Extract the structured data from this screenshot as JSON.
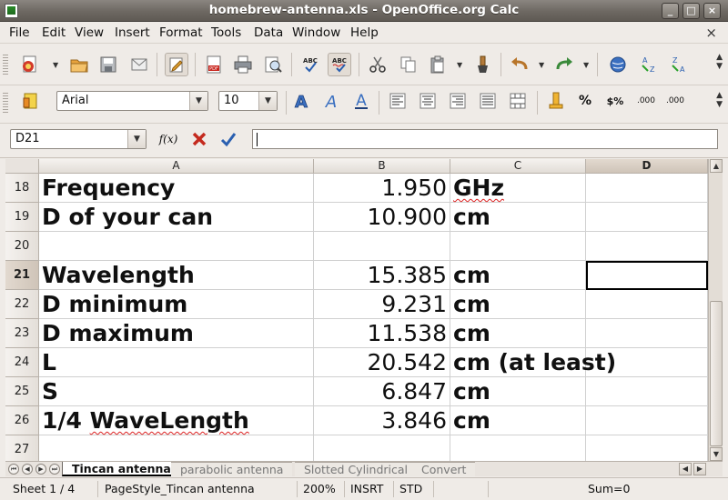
{
  "window": {
    "title": "homebrew-antenna.xls - OpenOffice.org Calc",
    "buttons": {
      "minimize": "_",
      "maximize": "□",
      "close": "×"
    }
  },
  "menu": {
    "items": [
      "File",
      "Edit",
      "View",
      "Insert",
      "Format",
      "Tools",
      "Data",
      "Window",
      "Help"
    ],
    "close_glyph": "×"
  },
  "toolbar_format": {
    "font_name": "Arial",
    "font_size": "10",
    "percent_label": "%",
    "currency_label": "$%",
    "add_decimal_label": ".000",
    "remove_decimal_label": ".000"
  },
  "formula_bar": {
    "name_box": "D21",
    "function_label": "f(x)",
    "input_value": ""
  },
  "sheet": {
    "columns": [
      "A",
      "B",
      "C",
      "D"
    ],
    "selected_column": "D",
    "selected_row": "21",
    "active_cell": "D21",
    "rows": [
      {
        "num": "18",
        "a": "Frequency",
        "b": "1.950",
        "c": "GHz",
        "d": ""
      },
      {
        "num": "19",
        "a": "D of your can",
        "b": "10.900",
        "c": "cm",
        "d": ""
      },
      {
        "num": "20",
        "a": "",
        "b": "",
        "c": "",
        "d": ""
      },
      {
        "num": "21",
        "a": "Wavelength",
        "b": "15.385",
        "c": "cm",
        "d": ""
      },
      {
        "num": "22",
        "a": "D minimum",
        "b": "9.231",
        "c": "cm",
        "d": ""
      },
      {
        "num": "23",
        "a": "D maximum",
        "b": "11.538",
        "c": "cm",
        "d": ""
      },
      {
        "num": "24",
        "a": "L",
        "b": "20.542",
        "c": "cm (at least)",
        "d": ""
      },
      {
        "num": "25",
        "a": "S",
        "b": "6.847",
        "c": "cm",
        "d": ""
      },
      {
        "num": "26",
        "a": "1/4 WaveLength",
        "b": "3.846",
        "c": "cm",
        "d": ""
      },
      {
        "num": "27",
        "a": "",
        "b": "",
        "c": "",
        "d": ""
      }
    ]
  },
  "tabs": [
    "Tincan antenna",
    "parabolic antenna",
    "Slotted Cylindrical",
    "Convert"
  ],
  "active_tab": "Tincan antenna",
  "status": {
    "sheet": "Sheet 1 / 4",
    "page_style": "PageStyle_Tincan antenna",
    "zoom": "200%",
    "insert_mode": "INSRT",
    "selection_mode": "STD",
    "sum": "Sum=0"
  },
  "colors": {
    "titlebar": "#6d6862",
    "chrome": "#efebe7",
    "selection_header": "#cfc4b8",
    "spell_error": "#dd2222"
  }
}
